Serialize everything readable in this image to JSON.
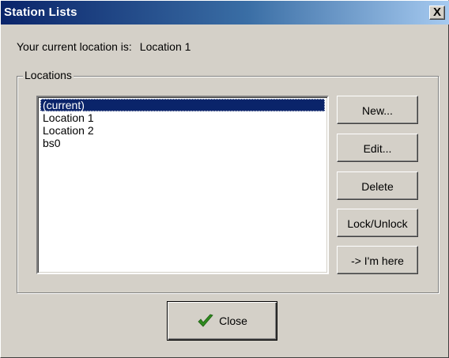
{
  "window": {
    "title": "Station Lists",
    "close_glyph": "X"
  },
  "location": {
    "label": "Your current location is:",
    "value": "Location 1"
  },
  "group": {
    "label": "Locations"
  },
  "list": {
    "items": [
      "(current)",
      "Location 1",
      "Location 2",
      "bs0"
    ],
    "selected_index": 0
  },
  "buttons": {
    "new": "New...",
    "edit": "Edit...",
    "delete": "Delete",
    "lock": "Lock/Unlock",
    "im_here": "-> I'm here",
    "close": "Close"
  },
  "icons": {
    "close_button_icon": "check-icon",
    "check_color": "#2e8b1e"
  },
  "colors": {
    "title_start": "#0a246a",
    "title_end": "#a6caf0",
    "face": "#d4d0c8",
    "selection": "#0a246a"
  }
}
